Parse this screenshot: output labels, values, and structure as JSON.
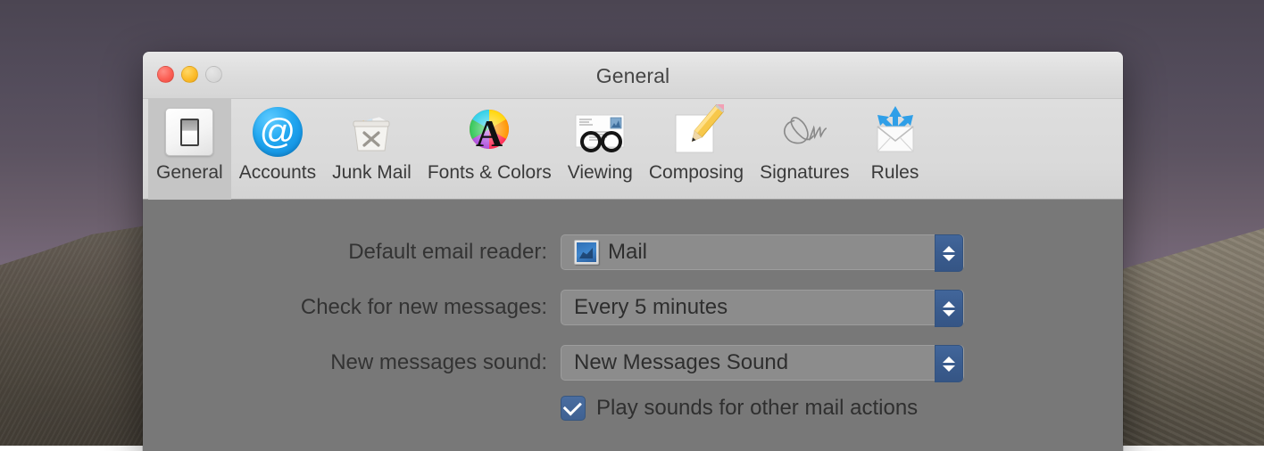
{
  "desktop": {
    "wallpaper_description": "dusk mountain ridge wallpaper",
    "sky_color": "#6a5e6b",
    "ridge_color": "#4e473e"
  },
  "window": {
    "title": "General",
    "traffic_lights": [
      {
        "name": "close",
        "label": "Close",
        "color": "#fc6055",
        "enabled": true
      },
      {
        "name": "minimize",
        "label": "Minimize",
        "color": "#fcbc2b",
        "enabled": true
      },
      {
        "name": "zoom",
        "label": "Zoom",
        "color": "#d9d9d9",
        "enabled": false
      }
    ]
  },
  "toolbar": {
    "selected": "General",
    "items": [
      {
        "label": "General",
        "icon": "light-switch-icon"
      },
      {
        "label": "Accounts",
        "icon": "at-sign-icon"
      },
      {
        "label": "Junk Mail",
        "icon": "trash-bin-icon"
      },
      {
        "label": "Fonts & Colors",
        "icon": "color-wheel-letter-a-icon"
      },
      {
        "label": "Viewing",
        "icon": "envelope-glasses-icon"
      },
      {
        "label": "Composing",
        "icon": "pencil-page-icon"
      },
      {
        "label": "Signatures",
        "icon": "signature-icon"
      },
      {
        "label": "Rules",
        "icon": "envelope-arrows-icon"
      }
    ]
  },
  "general_pane": {
    "rows": [
      {
        "label": "Default email reader:",
        "value": "Mail",
        "has_app_icon": true,
        "app_icon": "mail-app-icon"
      },
      {
        "label": "Check for new messages:",
        "value": "Every 5 minutes",
        "has_app_icon": false
      },
      {
        "label": "New messages sound:",
        "value": "New Messages Sound",
        "has_app_icon": false
      }
    ],
    "checkbox": {
      "label": "Play sounds for other mail actions",
      "checked": true,
      "accent_color": "#3f6192"
    }
  }
}
